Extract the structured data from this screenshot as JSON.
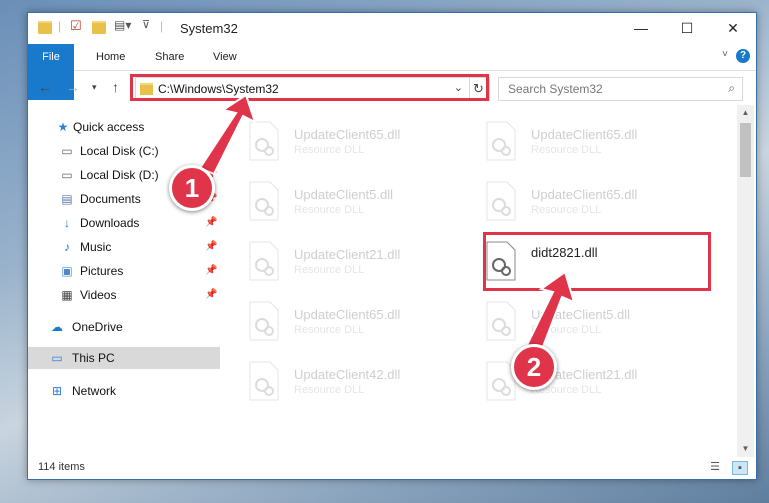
{
  "window": {
    "title": "System32"
  },
  "ribbon": {
    "tabs": [
      "File",
      "Home",
      "Share",
      "View"
    ],
    "help": "?"
  },
  "address": {
    "path": "C:\\Windows\\System32"
  },
  "search": {
    "placeholder": "Search System32"
  },
  "sidebar": {
    "items": [
      {
        "label": "Quick access",
        "icon": "star-icon",
        "pinned": false
      },
      {
        "label": "Local Disk (C:)",
        "icon": "drive-icon",
        "pinned": false
      },
      {
        "label": "Local Disk (D:)",
        "icon": "drive-icon",
        "pinned": true
      },
      {
        "label": "Documents",
        "icon": "documents-icon",
        "pinned": true
      },
      {
        "label": "Downloads",
        "icon": "download-icon",
        "pinned": true
      },
      {
        "label": "Music",
        "icon": "music-icon",
        "pinned": true
      },
      {
        "label": "Pictures",
        "icon": "pictures-icon",
        "pinned": true
      },
      {
        "label": "Videos",
        "icon": "videos-icon",
        "pinned": true
      },
      {
        "label": "OneDrive",
        "icon": "cloud-icon",
        "pinned": false
      },
      {
        "label": "This PC",
        "icon": "computer-icon",
        "pinned": false
      },
      {
        "label": "Network",
        "icon": "network-icon",
        "pinned": false
      }
    ]
  },
  "files": [
    {
      "name": "UpdateClient65.dll",
      "type": "Resource DLL"
    },
    {
      "name": "UpdateClient65.dll",
      "type": "Resource DLL"
    },
    {
      "name": "UpdateClient5.dll",
      "type": "Resource DLL"
    },
    {
      "name": "UpdateClient65.dll",
      "type": "Resource DLL"
    },
    {
      "name": "UpdateClient21.dll",
      "type": "Resource DLL"
    },
    {
      "name": "didt2821.dll",
      "type": ""
    },
    {
      "name": "UpdateClient65.dll",
      "type": "Resource DLL"
    },
    {
      "name": "UpdateClient5.dll",
      "type": "Resource DLL"
    },
    {
      "name": "UpdateClient42.dll",
      "type": "Resource DLL"
    },
    {
      "name": "UpdateClient21.dll",
      "type": "Resource DLL"
    }
  ],
  "status": {
    "item_count": "114 items"
  },
  "callouts": {
    "one": "1",
    "two": "2"
  },
  "colors": {
    "accent": "#1979ca",
    "highlight": "#e0344b"
  }
}
